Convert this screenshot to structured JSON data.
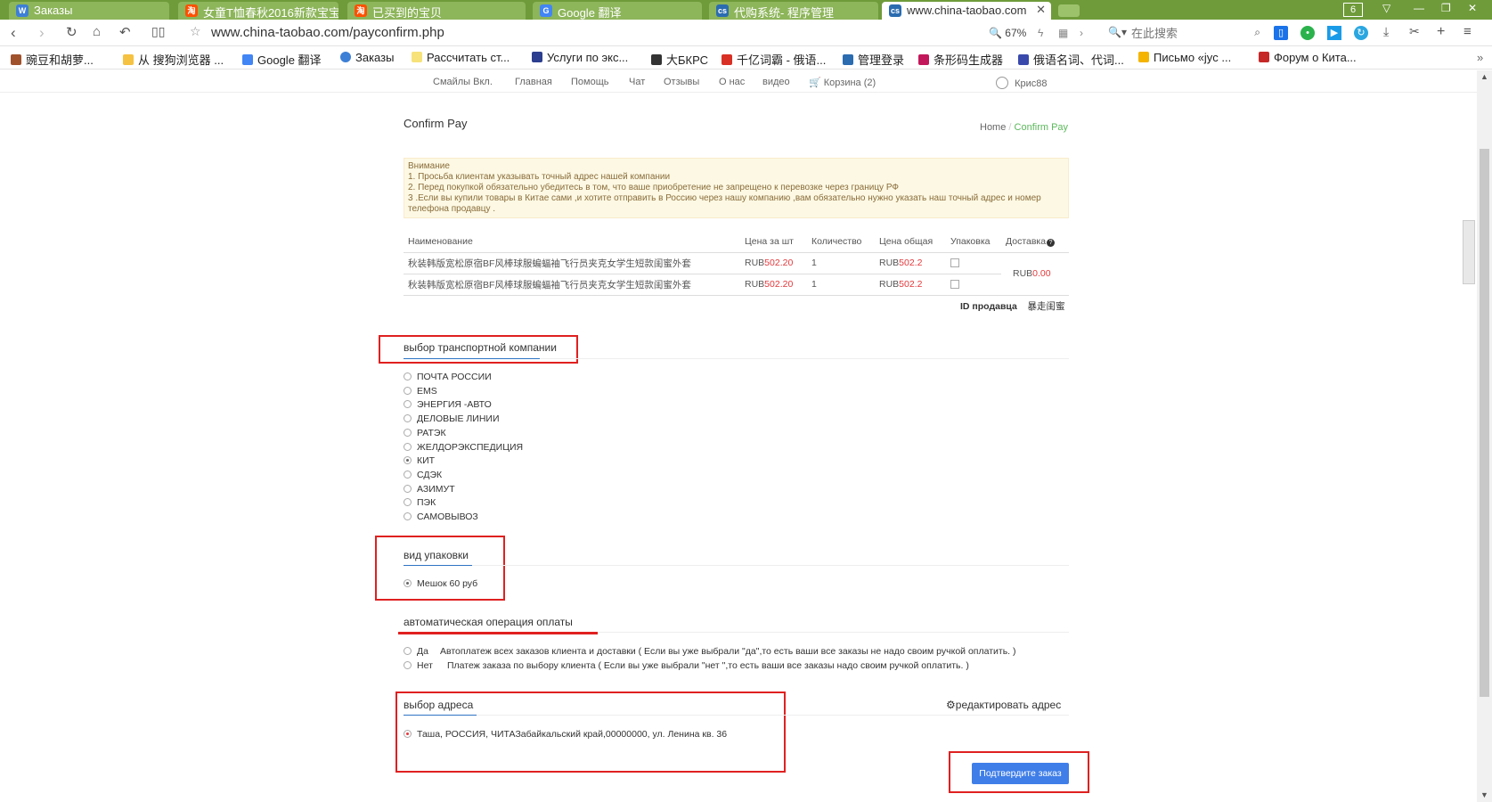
{
  "browser": {
    "tabs": [
      {
        "label": "Заказы",
        "icon": "W",
        "color": "#3d7fd6"
      },
      {
        "label": "女童T恤春秋2016新款宝宝",
        "icon": "淘",
        "color": "#ff5000"
      },
      {
        "label": "已买到的宝贝",
        "icon": "淘",
        "color": "#ff5000"
      },
      {
        "label": "Google 翻译",
        "icon": "G",
        "color": "#4285f4"
      },
      {
        "label": "代购系统- 程序管理",
        "icon": "cs",
        "color": "#2b6cb0"
      },
      {
        "label": "www.china-taobao.com",
        "icon": "cs",
        "color": "#2b6cb0"
      }
    ],
    "tab_count": "6",
    "url": "www.china-taobao.com/payconfirm.php",
    "zoom": "67%",
    "search_placeholder": "在此搜索",
    "bookmarks": [
      "豌豆和胡萝...",
      "从 搜狗浏览器 ...",
      "Google 翻译",
      "Заказы",
      "Рассчитать ст...",
      "Услуги по экс...",
      "大БКРС",
      "千亿词霸 - 俄语...",
      "管理登录",
      "条形码生成器",
      "俄语名词、代词...",
      "Письмо «jyc ...",
      "Форум о Кита..."
    ]
  },
  "site_nav": {
    "items": [
      "Смайлы Вкл.",
      "Главная",
      "Помощь",
      "Чат",
      "Отзывы",
      "О нас",
      "видео"
    ],
    "cart_label": "Корзина",
    "cart_count": "(2)",
    "user": "Крис88"
  },
  "page": {
    "title": "Confirm Pay",
    "breadcrumb_home": "Home",
    "breadcrumb_sep": "/",
    "breadcrumb_current": "Confirm Pay"
  },
  "notice": {
    "heading": "Внимание",
    "lines": [
      "1. Просьба клиентам указывать точный адрес нашей компании",
      "2. Перед покупкой обязательно убедитесь в том, что ваше приобретение не запрещено к перевозке через границу РФ",
      "3 .Если вы купили товары в Китае сами ,и хотите отправить в Россию через нашу компанию ,вам обязательно нужно указать наш точный адрес и номер телефона продавцу ."
    ]
  },
  "order_table": {
    "headers": [
      "Наименование",
      "Цена за шт",
      "Количество",
      "Цена общая",
      "Упаковка",
      "Доставка"
    ],
    "currency": "RUB",
    "rows": [
      {
        "name": "秋装韩版宽松原宿BF风棒球服蝙蝠袖飞行员夹克女学生短款闺蜜外套",
        "price": "502.20",
        "qty": "1",
        "total": "502.2"
      },
      {
        "name": "秋装韩版宽松原宿BF风棒球服蝙蝠袖飞行员夹克女学生短款闺蜜外套",
        "price": "502.20",
        "qty": "1",
        "total": "502.2"
      }
    ],
    "shipping": "0.00",
    "seller_label": "ID продавца",
    "seller_id": "暴走闺蜜"
  },
  "transport": {
    "title": "выбор транспортной компании",
    "options": [
      "ПОЧТА РОССИИ",
      "EMS",
      "ЭНЕРГИЯ -АВТО",
      "ДЕЛОВЫЕ ЛИНИИ",
      "РАТЭК",
      "ЖЕЛДОРЭКСПЕДИЦИЯ",
      "КИТ",
      "СДЭК",
      "АЗИМУТ",
      "ПЭК",
      "САМОВЫВОЗ"
    ],
    "selected": "КИТ"
  },
  "packaging": {
    "title": "вид упаковки",
    "option": "Мешок 60 руб"
  },
  "autopay": {
    "title": "автоматическая операция оплаты",
    "options": [
      {
        "label": "Да",
        "desc": "Автоплатеж всех заказов клиента и доставки ( Если вы уже выбрали \"да\",то есть ваши все заказы не надо своим ручкой оплатить. )"
      },
      {
        "label": "Нет",
        "desc": "Платеж заказа по выбору клиента ( Если вы уже выбрали \"нет \",то есть ваши все заказы надо своим ручкой оплатить. )"
      }
    ]
  },
  "address": {
    "title": "выбор адреса",
    "edit_label": "редактировать адрес",
    "value": "Таша, РОССИЯ, ЧИТАЗабайкальский край,00000000, ул. Ленина кв. 36"
  },
  "confirm_button": "Подтвердите заказ",
  "colors": {
    "accent": "#3f7ee8",
    "highlight": "#e02020",
    "price": "#e4393c",
    "browser_green": "#6f9b3a"
  }
}
